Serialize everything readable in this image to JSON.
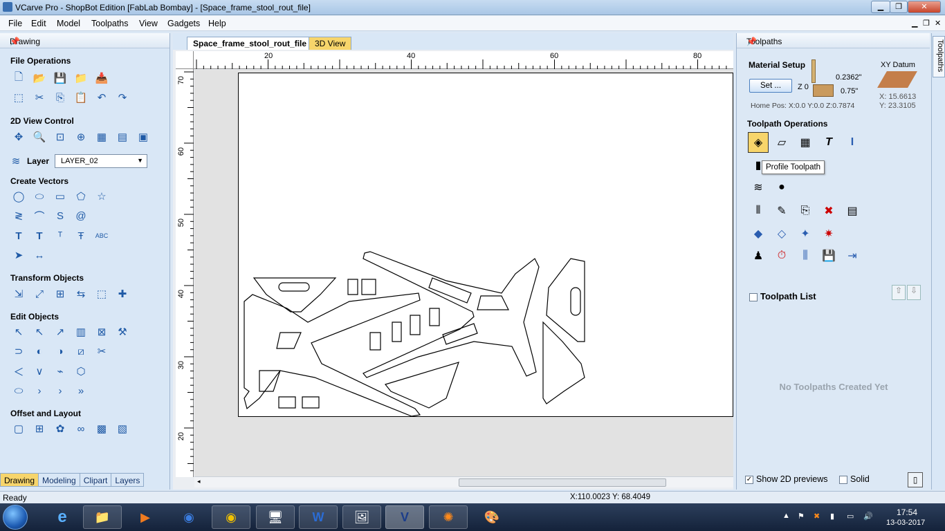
{
  "window": {
    "title": "VCarve Pro - ShopBot Edition [FabLab Bombay] - [Space_frame_stool_rout_file]"
  },
  "menu": [
    "File",
    "Edit",
    "Model",
    "Toolpaths",
    "View",
    "Gadgets",
    "Help"
  ],
  "left_panel": {
    "header": "Drawing",
    "sections": {
      "file_ops": "File Operations",
      "view_control": "2D View Control",
      "create_vectors": "Create Vectors",
      "transform": "Transform Objects",
      "edit": "Edit Objects",
      "offset": "Offset and Layout"
    },
    "layer_label": "Layer",
    "layer_value": "LAYER_02",
    "tabs": [
      "Drawing",
      "Modeling",
      "Clipart",
      "Layers"
    ]
  },
  "doc": {
    "tabs": [
      "Space_frame_stool_rout_file",
      "3D View"
    ],
    "hruler": [
      "20",
      "40",
      "60",
      "80"
    ],
    "vruler": [
      "70",
      "60",
      "50",
      "40",
      "30",
      "20"
    ]
  },
  "right_panel": {
    "header": "Toolpaths",
    "material_setup": "Material Setup",
    "set_button": "Set ...",
    "z0": "Z 0",
    "thickness_top": "0.2362\"",
    "thickness": "0.75\"",
    "home_pos": "Home Pos:  X:0.0 Y:0.0 Z:0.7874",
    "xy_datum": "XY Datum",
    "datum_x": "X: 15.6613",
    "datum_y": "Y: 23.3105",
    "toolpath_ops": "Toolpath Operations",
    "tooltip": "Profile Toolpath",
    "list_title": "Toolpath List",
    "empty": "No Toolpaths Created Yet",
    "show_previews": "Show 2D previews",
    "solid": "Solid",
    "side_tab": "Toolpaths"
  },
  "status": {
    "left": "Ready",
    "coords": "X:110.0023 Y: 68.4049"
  },
  "taskbar": {
    "time": "17:54",
    "date": "13-03-2017"
  }
}
